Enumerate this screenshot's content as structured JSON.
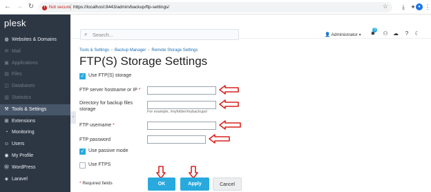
{
  "browser": {
    "not_secure_label": "Not secure",
    "url": "https://localhost:8443/admin/backup/ftp-settings/"
  },
  "sidebar": {
    "logo": "plesk",
    "items": [
      {
        "label": "Websites & Domains",
        "icon": "globe-icon",
        "state": "normal"
      },
      {
        "label": "Mail",
        "icon": "mail-icon",
        "state": "disabled"
      },
      {
        "label": "Applications",
        "icon": "applications-icon",
        "state": "disabled"
      },
      {
        "label": "Files",
        "icon": "files-icon",
        "state": "disabled"
      },
      {
        "label": "Databases",
        "icon": "databases-icon",
        "state": "disabled"
      },
      {
        "label": "Statistics",
        "icon": "statistics-icon",
        "state": "disabled"
      },
      {
        "label": "Tools & Settings",
        "icon": "tools-icon",
        "state": "active"
      },
      {
        "label": "Extensions",
        "icon": "extensions-icon",
        "state": "normal"
      },
      {
        "label": "Monitoring",
        "icon": "monitoring-icon",
        "state": "normal"
      },
      {
        "label": "Users",
        "icon": "users-icon",
        "state": "normal"
      },
      {
        "label": "My Profile",
        "icon": "profile-icon",
        "state": "normal"
      },
      {
        "label": "WordPress",
        "icon": "wordpress-icon",
        "state": "normal"
      },
      {
        "label": "Laravel",
        "icon": "laravel-icon",
        "state": "normal"
      }
    ]
  },
  "header": {
    "search_placeholder": "Search...",
    "user_label": "Administrator",
    "notification_count": "3"
  },
  "breadcrumb": [
    "Tools & Settings",
    "Backup Manager",
    "Remote Storage Settings"
  ],
  "page_title": "FTP(S) Storage Settings",
  "form": {
    "use_ftp_label": "Use FTP(S) storage",
    "use_ftp_checked": true,
    "hostname_label": "FTP server hostname or IP",
    "directory_label": "Directory for backup files storage",
    "directory_hint": "For example, /myfolder/mybackups/",
    "username_label": "FTP username",
    "password_label": "FTP password",
    "passive_label": "Use passive mode",
    "passive_checked": true,
    "ftps_label": "Use FTPS",
    "ftps_checked": false,
    "required_star": "*",
    "required_note": "Required fields",
    "ok_label": "OK",
    "apply_label": "Apply",
    "cancel_label": "Cancel"
  },
  "colors": {
    "sidebar_bg": "#2d3744",
    "accent": "#28aade",
    "annotation_red": "#d9211b"
  }
}
